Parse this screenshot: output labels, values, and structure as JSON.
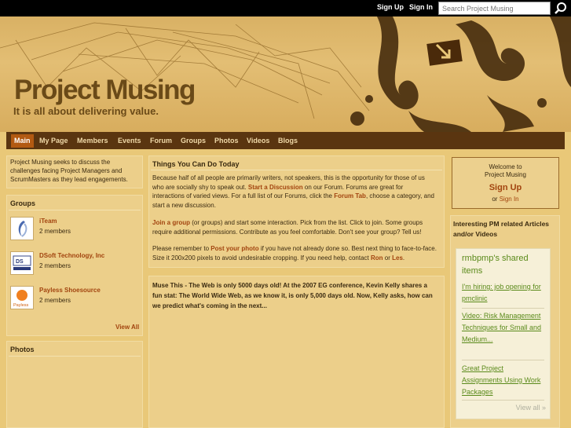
{
  "topbar": {
    "signup": "Sign Up",
    "signin": "Sign In",
    "search_placeholder": "Search Project Musing",
    "search_icon": "search-icon"
  },
  "header": {
    "title": "Project Musing",
    "tagline": "It is all about delivering value."
  },
  "nav": [
    "Main",
    "My Page",
    "Members",
    "Events",
    "Forum",
    "Groups",
    "Photos",
    "Videos",
    "Blogs"
  ],
  "left": {
    "about": "Project Musing seeks to discuss the challenges facing Project Managers and ScrumMasters as they lead engagements.",
    "groups_title": "Groups",
    "groups": [
      {
        "name": "iTeam",
        "members": "2 members"
      },
      {
        "name": "DSoft Technology, Inc",
        "members": "2 members"
      },
      {
        "name": "Payless Shoesource",
        "members": "2 members"
      }
    ],
    "view_all": "View All",
    "photos_title": "Photos"
  },
  "center": {
    "things_title": "Things You Can Do Today",
    "p1_a": "Because half of all people are primarily writers, not speakers, this is the opportunity for those of us who are socially shy to speak out.",
    "p1_link1": "Start a Discussion",
    "p1_b": "on our Forum. Forums are great for interactions of varied views. For a full list of our Forums, click the",
    "p1_link2": "Forum Tab",
    "p1_c": ", choose a category, and start a new discussion.",
    "p2_link": "Join a group",
    "p2_text": "(or groups) and start some interaction. Pick from the list. Click to join. Some groups require additional permissions. Contribute as you feel comfortable. Don't see your group? Tell us!",
    "p3_a": "Please remember to",
    "p3_link": "Post your photo",
    "p3_b": "if you have not already done so. Best next thing to face-to-face. Size it 200x200 pixels to avoid undesirable cropping. If you need help, contact",
    "p3_ron": "Ron",
    "p3_or": "or",
    "p3_les": "Les",
    "p3_end": ".",
    "muse": "Muse This - The Web is only 5000 days old! At the 2007 EG conference, Kevin Kelly shares a fun stat: The World Wide Web, as we know it, is only 5,000 days old. Now, Kelly asks, how can we predict what's coming in the next..."
  },
  "right": {
    "welcome": "Welcome to",
    "welcome_site": "Project Musing",
    "signup": "Sign Up",
    "or": "or",
    "signin": "Sign In",
    "interesting_title": "Interesting PM related Articles and/or Videos",
    "rss_title": "rmbpmp's shared items",
    "rss_items": [
      "I'm hiring: job opening for pmclinic",
      "Video: Risk Management Techniques for Small and Medium...",
      "Great Project Assignments Using Work Packages"
    ],
    "rss_view_all": "View all »"
  },
  "colors": {
    "accent": "#a2440f",
    "nav_bg": "#5a3510",
    "nav_active": "#b35a12",
    "feed_green": "#5a8a1a"
  }
}
